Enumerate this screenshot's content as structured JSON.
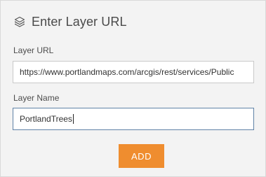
{
  "header": {
    "title": "Enter Layer URL",
    "icon": "layers-icon"
  },
  "layer_url": {
    "label": "Layer URL",
    "value": "https://www.portlandmaps.com/arcgis/rest/services/Public"
  },
  "layer_name": {
    "label": "Layer Name",
    "value": "PortlandTrees"
  },
  "add_button": {
    "label": "ADD"
  },
  "colors": {
    "panel_background": "#f3f3f3",
    "accent": "#ef8d2f",
    "focus_border": "#5f82a7"
  }
}
